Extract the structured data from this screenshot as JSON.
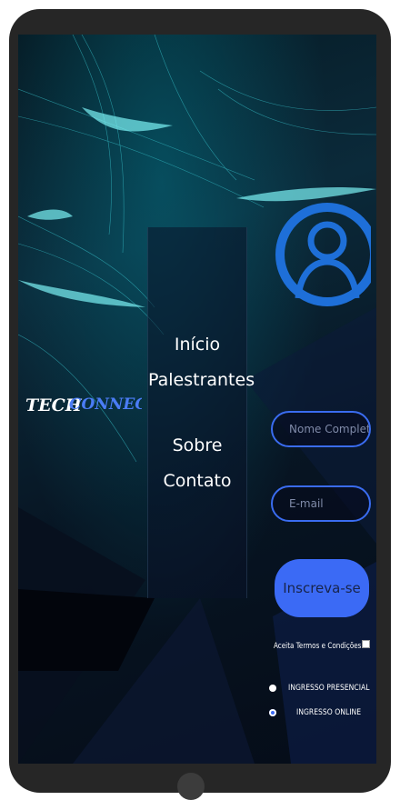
{
  "brand": {
    "logo_text_tech": "TECH",
    "logo_text_connect": "CONNECT"
  },
  "nav": {
    "items": [
      {
        "label": "Início"
      },
      {
        "label": "Palestrantes"
      },
      {
        "label": "Sobre"
      },
      {
        "label": "Contato"
      }
    ]
  },
  "form": {
    "name_placeholder": "Nome Completo",
    "email_placeholder": "E-mail",
    "submit_label": "Inscreva-se",
    "terms_label": "Aceita Termos e Condições",
    "terms_checked": false,
    "ticket_options": [
      {
        "label": "INGRESSO PRESENCIAL",
        "selected": false
      },
      {
        "label": "INGRESSO ONLINE",
        "selected": true
      }
    ]
  },
  "icons": {
    "avatar": "user-circle-icon",
    "home_button": "home-button"
  },
  "colors": {
    "accent": "#3b6af5",
    "avatar_ring": "#1e6fd8",
    "background": "#071523",
    "frame": "#262626"
  }
}
